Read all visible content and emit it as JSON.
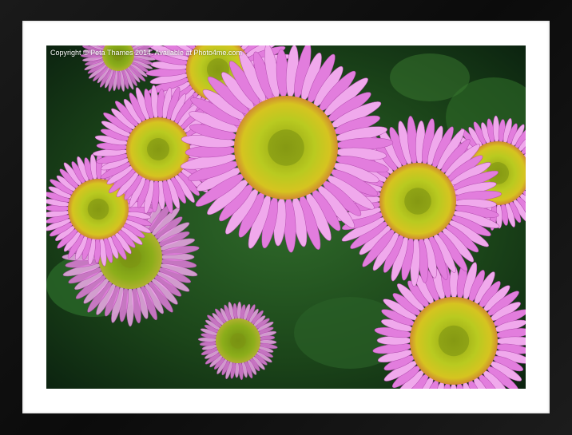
{
  "frame": {
    "color": "#111111",
    "mat_color": "#ffffff"
  },
  "photo": {
    "subject": "pink daisy flowers",
    "overlay_text": "Copyright © Peta Thames 2014. Available at Photo4me.com",
    "colors": {
      "petal": "#e77fe0",
      "petal_light": "#f4b6f0",
      "center": "#b8c820",
      "center_dark": "#7a8a10",
      "foliage": "#1d4a1f"
    }
  }
}
